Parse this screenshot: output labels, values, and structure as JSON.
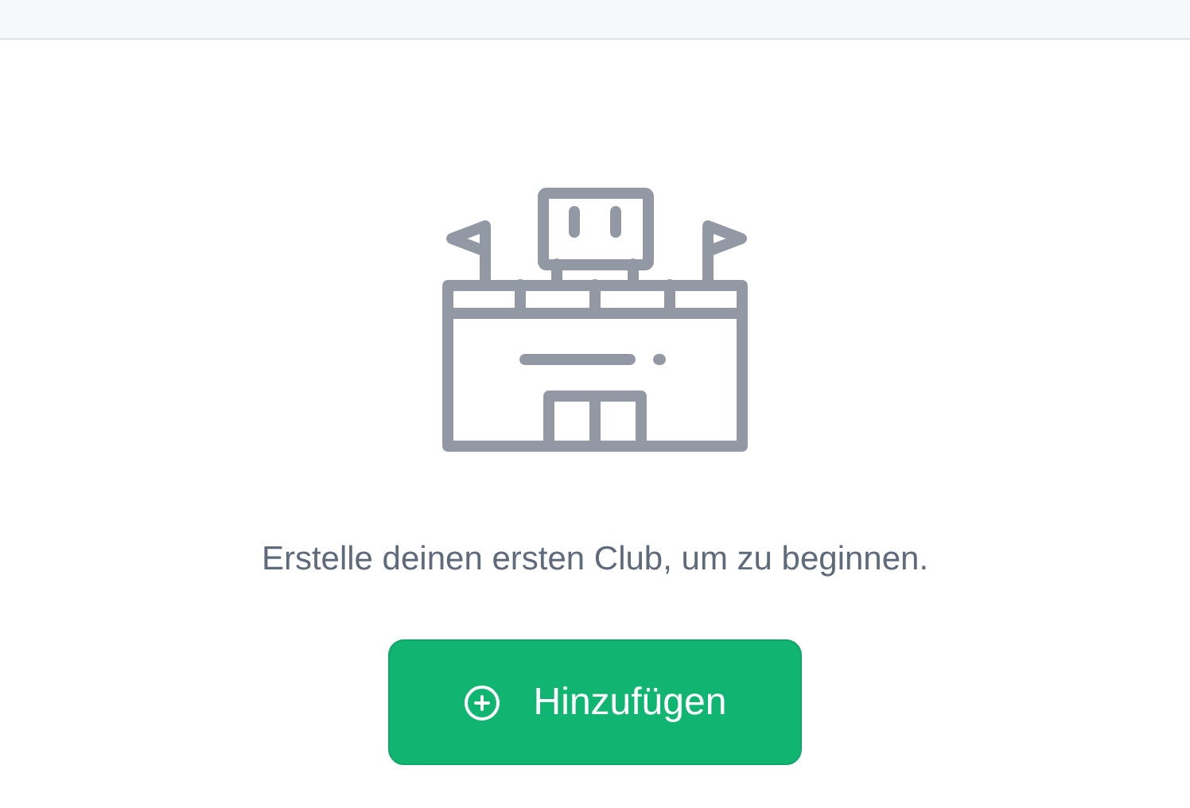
{
  "empty_state": {
    "message": "Erstelle deinen ersten Club, um zu beginnen.",
    "add_button": {
      "label": "Hinzufügen"
    }
  }
}
